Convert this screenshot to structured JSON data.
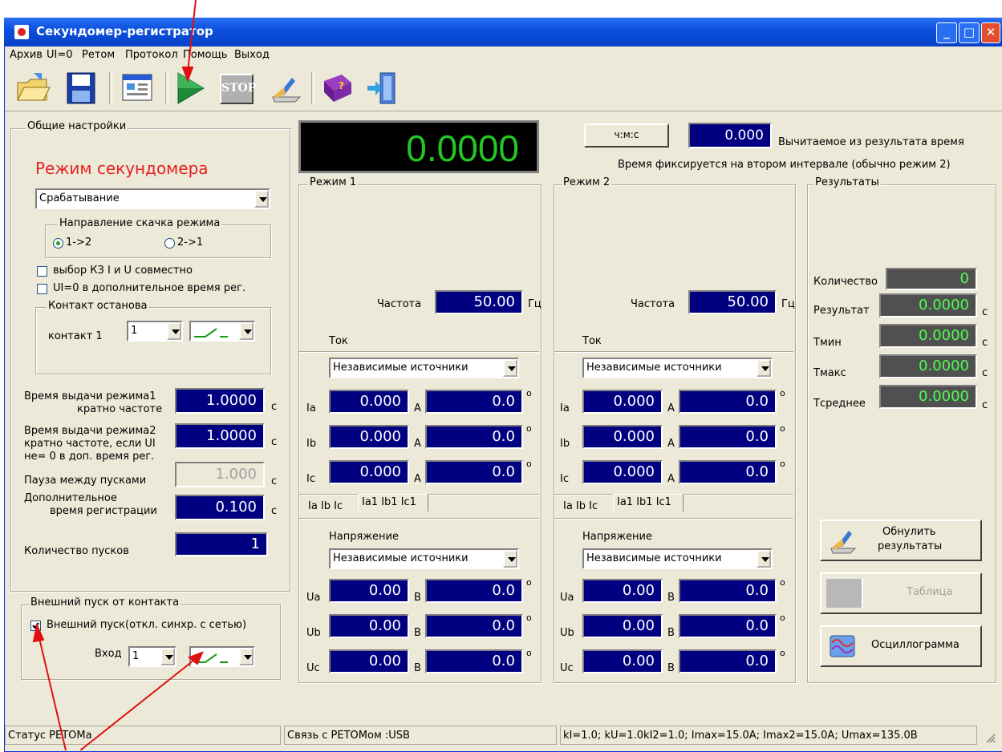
{
  "window": {
    "title": "Секундомер-регистратор"
  },
  "menu": [
    "Архив",
    "UI=0",
    "Ретом",
    "Протокол",
    "Помощь",
    "Выход"
  ],
  "toolbar": {
    "stop_label": "STOP"
  },
  "general": {
    "group_title": "Общие настройки",
    "mode_heading": "Режим секундомера",
    "mode_select": "Срабатывание",
    "direction_title": "Направление скачка режима",
    "dir1": "1->2",
    "dir2": "2->1",
    "chk_kz": "выбор КЗ  I и U совместно",
    "chk_ui0": "UI=0 в дополнительное время рег.",
    "stop_contact_title": "Контакт останова",
    "contact_label": "контакт 1",
    "contact_value": "1",
    "time1_label_a": "Время выдачи режима1",
    "time1_label_b": "кратно частоте",
    "time1_value": "1.0000",
    "time2_label_a": "Время выдачи режима2",
    "time2_label_b": "кратно частоте, если UI",
    "time2_label_c": "не= 0 в доп. время рег.",
    "time2_value": "1.0000",
    "pause_label": "Пауза между пусками",
    "pause_value": "1.000",
    "extra_label_a": "Дополнительное",
    "extra_label_b": "время регистрации",
    "extra_value": "0.100",
    "count_label": "Количество пусков",
    "count_value": "1",
    "unit_c": "с"
  },
  "external": {
    "group_title": "Внешний пуск от контакта",
    "chk_label": "Внешний пуск(откл. синхр. с сетью)",
    "input_label": "Вход",
    "input_value": "1"
  },
  "timer": {
    "display": "0.0000"
  },
  "top": {
    "hms_button": "ч:м:с",
    "subtract_value": "0.000",
    "subtract_label": "Вычитаемое из результата время",
    "note": "Время фиксируется на втором интервале (обычно режим 2)"
  },
  "mode1": {
    "title": "Режим 1",
    "freq_label": "Частота",
    "freq_value": "50.00",
    "freq_unit": "Гц",
    "current_title": "Ток",
    "current_source": "Независимые источники",
    "ia": "0.000",
    "ia_ang": "0.0",
    "ib": "0.000",
    "ib_ang": "0.0",
    "ic": "0.000",
    "ic_ang": "0.0",
    "tab1": "Ia Ib Ic",
    "tab2": "Ia1 Ib1 Ic1",
    "voltage_title": "Напряжение",
    "voltage_source": "Независимые источники",
    "ua": "0.00",
    "ua_ang": "0.0",
    "ub": "0.00",
    "ub_ang": "0.0",
    "uc": "0.00",
    "uc_ang": "0.0"
  },
  "mode2": {
    "title": "Режим 2",
    "freq_label": "Частота",
    "freq_value": "50.00",
    "freq_unit": "Гц",
    "current_title": "Ток",
    "current_source": "Независимые источники",
    "ia": "0.000",
    "ia_ang": "0.0",
    "ib": "0.000",
    "ib_ang": "0.0",
    "ic": "0.000",
    "ic_ang": "0.0",
    "tab1": "Ia Ib Ic",
    "tab2": "Ia1 Ib1 Ic1",
    "voltage_title": "Напряжение",
    "voltage_source": "Независимые источники",
    "ua": "0.00",
    "ua_ang": "0.0",
    "ub": "0.00",
    "ub_ang": "0.0",
    "uc": "0.00",
    "uc_ang": "0.0"
  },
  "labels": {
    "Ia": "Ia",
    "Ib": "Ib",
    "Ic": "Ic",
    "Ua": "Ua",
    "Ub": "Ub",
    "Uc": "Uc",
    "amp": "A",
    "volt": "В",
    "deg": "o"
  },
  "results": {
    "title": "Результаты",
    "count_label": "Количество",
    "count_value": "0",
    "result_label": "Результат",
    "result_value": "0.0000",
    "tmin_label": "Тмин",
    "tmin_value": "0.0000",
    "tmax_label": "Тмакс",
    "tmax_value": "0.0000",
    "tavg_label": "Тсреднее",
    "tavg_value": "0.0000",
    "unit": "с",
    "reset_button_a": "Обнулить",
    "reset_button_b": "результаты",
    "table_button": "Таблица",
    "osc_button": "Осциллограмма"
  },
  "status": {
    "retom": "Статус РЕТОМа",
    "link": "Связь с РЕТОМом :USB",
    "coeffs": "kI=1.0; kU=1.0kI2=1.0; Imax=15.0A; Imax2=15.0A; Umax=135.0B"
  }
}
